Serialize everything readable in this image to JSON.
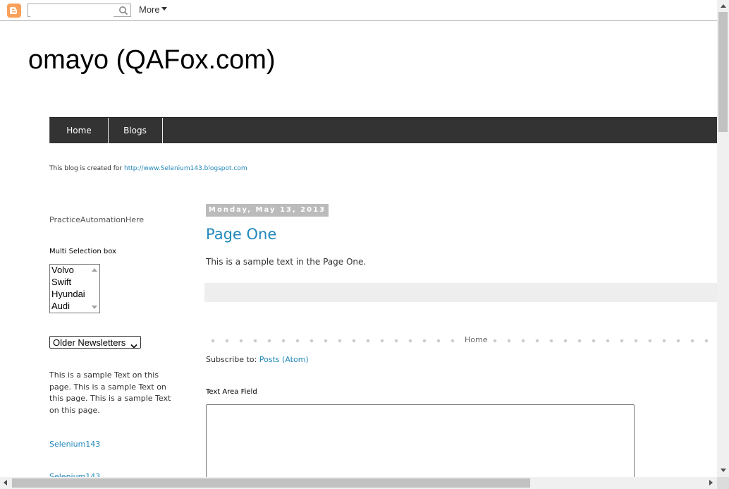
{
  "navbar": {
    "search_placeholder": "",
    "more_label": "More"
  },
  "header": {
    "title": "omayo (QAFox.com)",
    "description_prefix": "This blog is created for ",
    "description_link": "http://www.Selenium143.blogspot.com"
  },
  "tabs": [
    {
      "label": "Home"
    },
    {
      "label": "Blogs"
    }
  ],
  "sidebar": {
    "title": "PracticeAutomationHere",
    "multi_heading": "Multi Selection box",
    "multi_options": [
      "Volvo",
      "Swift",
      "Hyundai",
      "Audi"
    ],
    "dropdown_selected": "Older Newsletters",
    "text": "This is a sample Text on this page. This is a sample Text on this page. This is a sample Text on this page.",
    "link1": "Selenium143",
    "link2": "Selenium143"
  },
  "post": {
    "date": "Monday, May 13, 2013",
    "title": "Page One",
    "body": "This is a sample text in the Page One."
  },
  "pager": {
    "home_label": "Home"
  },
  "subscribe": {
    "prefix": "Subscribe to: ",
    "link": "Posts (Atom)"
  },
  "textarea": {
    "heading": "Text Area Field",
    "value": ""
  },
  "colors": {
    "accent_link": "#2288bb",
    "tabs_bg": "#333333",
    "blogger_orange": "#f9a05a"
  }
}
